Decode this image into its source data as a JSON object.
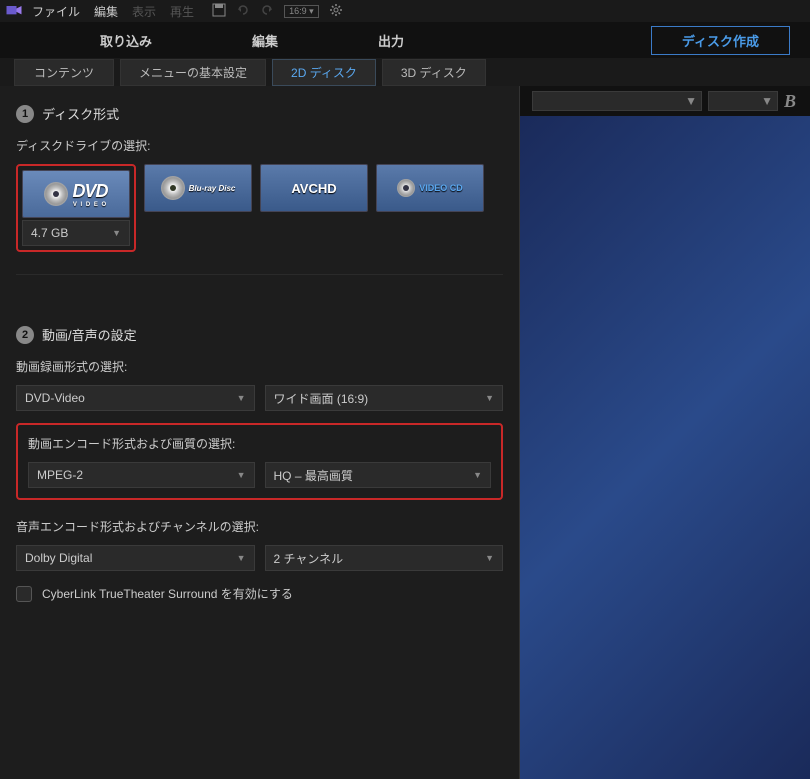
{
  "menu": {
    "file": "ファイル",
    "edit": "編集",
    "view": "表示",
    "play": "再生",
    "aspect": "16:9"
  },
  "tabs": {
    "import": "取り込み",
    "edit": "編集",
    "output": "出力",
    "create_disc": "ディスク作成"
  },
  "subtabs": {
    "contents": "コンテンツ",
    "menu_settings": "メニューの基本設定",
    "disc_2d": "2D ディスク",
    "disc_3d": "3D ディスク"
  },
  "section1": {
    "num": "1",
    "title": "ディスク形式",
    "drive_label": "ディスクドライブの選択:",
    "drives": {
      "dvd": "DVD",
      "dvd_sub": "V I D E O",
      "bluray": "Blu-ray Disc",
      "avchd": "AVCHD",
      "vcd": "VIDEO CD"
    },
    "capacity": "4.7 GB"
  },
  "section2": {
    "num": "2",
    "title": "動画/音声の設定",
    "video_format_label": "動画録画形式の選択:",
    "video_format": "DVD-Video",
    "aspect": "ワイド画面 (16:9)",
    "encode_label": "動画エンコード形式および画質の選択:",
    "codec": "MPEG-2",
    "quality": "HQ – 最高画質",
    "audio_label": "音声エンコード形式およびチャンネルの選択:",
    "audio_codec": "Dolby Digital",
    "channels": "2 チャンネル",
    "surround": "CyberLink TrueTheater Surround を有効にする"
  },
  "preview": {
    "bold": "B"
  }
}
